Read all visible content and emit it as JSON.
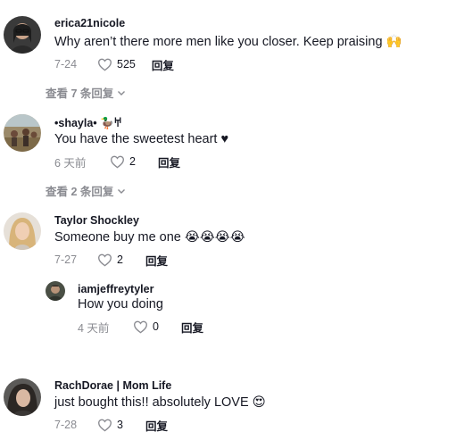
{
  "comments": [
    {
      "username": "erica21nicole",
      "text": "Why aren’t there more men like you closer. Keep praising",
      "emoji": "🙌",
      "date": "7-24",
      "likes": "525",
      "reply_label": "回复",
      "view_replies": "查看 7 条回复"
    },
    {
      "username": "•shayla•",
      "username_suffix": "🦆𐀀",
      "text": "You have the sweetest heart ♥",
      "date": "6 天前",
      "likes": "2",
      "reply_label": "回复",
      "view_replies": "查看 2 条回复"
    },
    {
      "username": "Taylor Shockley",
      "text": "Someone buy me one",
      "emoji": "😭😭😭😭",
      "date": "7-27",
      "likes": "2",
      "reply_label": "回复"
    },
    {
      "username": "iamjeffreytyler",
      "text": "How you doing",
      "date": "4 天前",
      "likes": "0",
      "reply_label": "回复"
    },
    {
      "username": "RachDorae | Mom Life",
      "text": "just bought this!! absolutely LOVE",
      "emoji": "😍",
      "date": "7-28",
      "likes": "3",
      "reply_label": "回复"
    }
  ],
  "icons": {
    "like": "heart-outline-icon",
    "expand": "chevron-down-icon"
  },
  "colors": {
    "muted": "#8a8b91",
    "text": "#161823"
  }
}
